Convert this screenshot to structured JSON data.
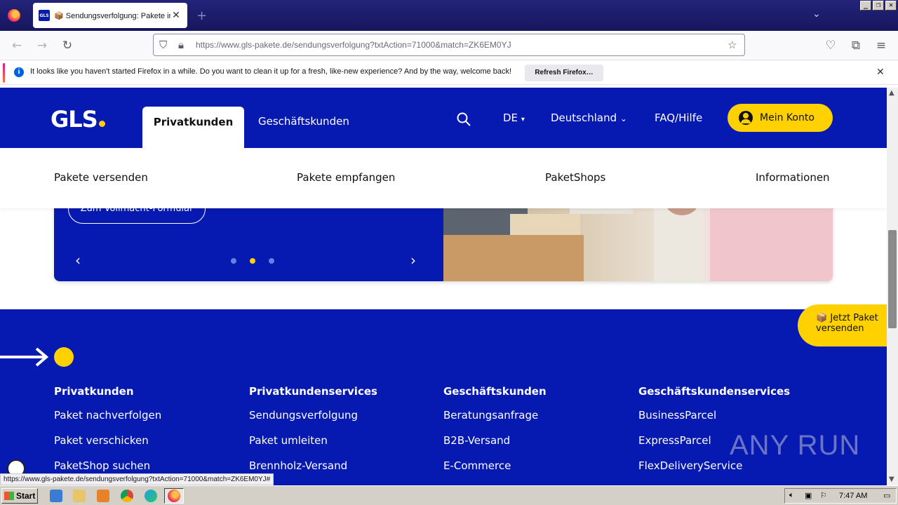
{
  "browser": {
    "tab_title": "📦 Sendungsverfolgung: Pakete im",
    "tab_favicon": "GLS",
    "url_domain": "https://www.gls-pakete.de",
    "url_path": "/sendungsverfolgung?txtAction=71000&match=ZK6EM0YJ",
    "notification": "It looks like you haven't started Firefox in a while. Do you want to clean it up for a fresh, like-new experience? And by the way, welcome back!",
    "refresh_label": "Refresh Firefox…",
    "status_url": "https://www.gls-pakete.de/sendungsverfolgung?txtAction=71000&match=ZK6EM0YJ#"
  },
  "header": {
    "logo": "GLS",
    "tab_private": "Privatkunden",
    "tab_business": "Geschäftskunden",
    "lang": "DE",
    "country": "Deutschland",
    "faq": "FAQ/Hilfe",
    "account": "Mein Konto"
  },
  "subnav": [
    "Pakete versenden",
    "Pakete empfangen",
    "PaketShops",
    "Informationen"
  ],
  "hero": {
    "button": "Zum Vollmacht-Formular",
    "active_slide": 2,
    "slides": 3
  },
  "fab": "📦 Jetzt Paket versenden",
  "footer": {
    "columns": [
      {
        "title": "Privatkunden",
        "items": [
          "Paket nachverfolgen",
          "Paket verschicken",
          "PaketShop suchen"
        ]
      },
      {
        "title": "Privatkundenservices",
        "items": [
          "Sendungsverfolgung",
          "Paket umleiten",
          "Brennholz-Versand"
        ]
      },
      {
        "title": "Geschäftskunden",
        "items": [
          "Beratungsanfrage",
          "B2B-Versand",
          "E-Commerce"
        ]
      },
      {
        "title": "Geschäftskundenservices",
        "items": [
          "BusinessParcel",
          "ExpressParcel",
          "FlexDeliveryService"
        ]
      }
    ]
  },
  "watermark": "ANY RUN",
  "taskbar": {
    "start": "Start",
    "clock": "7:47 AM"
  },
  "colors": {
    "gls_blue": "#061ab1",
    "gls_yellow": "#ffd100"
  }
}
